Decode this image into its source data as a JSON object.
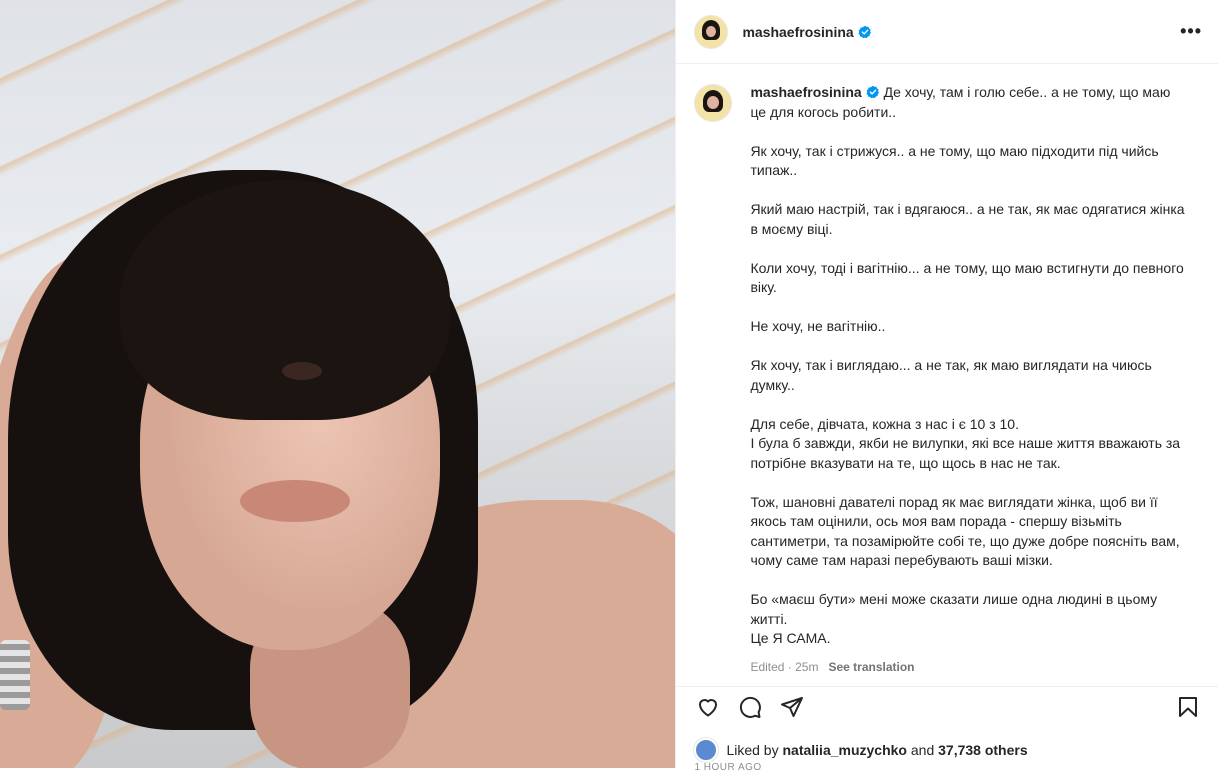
{
  "post": {
    "username": "mashaefrosinina",
    "verified": true,
    "more_label": "•••",
    "caption_paragraphs": [
      "Де хочу, там і голю себе.. а не тому, що маю це для когось робити..",
      "Як хочу, так і стрижуся.. а не тому, що маю підходити під чийсь типаж..",
      "Який маю настрій, так і вдягаюся.. а не так, як має одягатися жінка в моєму віці.",
      "Коли хочу, тоді і вагітнію... а не тому, що маю встигнути до певного віку.",
      "Не хочу, не вагітнію..",
      "Як хочу, так і виглядаю... а не так, як маю виглядати на чиюсь думку..",
      "Для себе, дівчата, кожна з нас і є 10 з 10.\nІ була б завжди, якби не вилупки, які все наше життя вважають за потрібне вказувати на те, що щось в нас не так.",
      "Тож, шановні давателі порад як має виглядати жінка, щоб ви її якось там оцінили, ось моя вам порада - спершу візьміть сантиметри, та позамірюйте собі те, що дуже добре поясніть вам, чому саме там наразі перебувають ваші мізки.",
      "Бо «маєш бути» мені може сказати лише одна людині в цьому житті.\nЦе Я САМА."
    ],
    "edited_label": "Edited · 25m",
    "see_translation": "See translation",
    "liked_by_prefix": "Liked by",
    "liked_by_user": "nataliia_muzychko",
    "liked_by_and": "and",
    "liked_by_others": "37,738 others",
    "time_ago": "1 HOUR AGO"
  },
  "icons": {
    "like": "heart-icon",
    "comment": "comment-icon",
    "share": "share-icon",
    "save": "bookmark-icon",
    "verified": "verified-badge-icon"
  },
  "colors": {
    "verified": "#0095f6",
    "text": "#262626",
    "secondary": "#8e8e8e"
  }
}
